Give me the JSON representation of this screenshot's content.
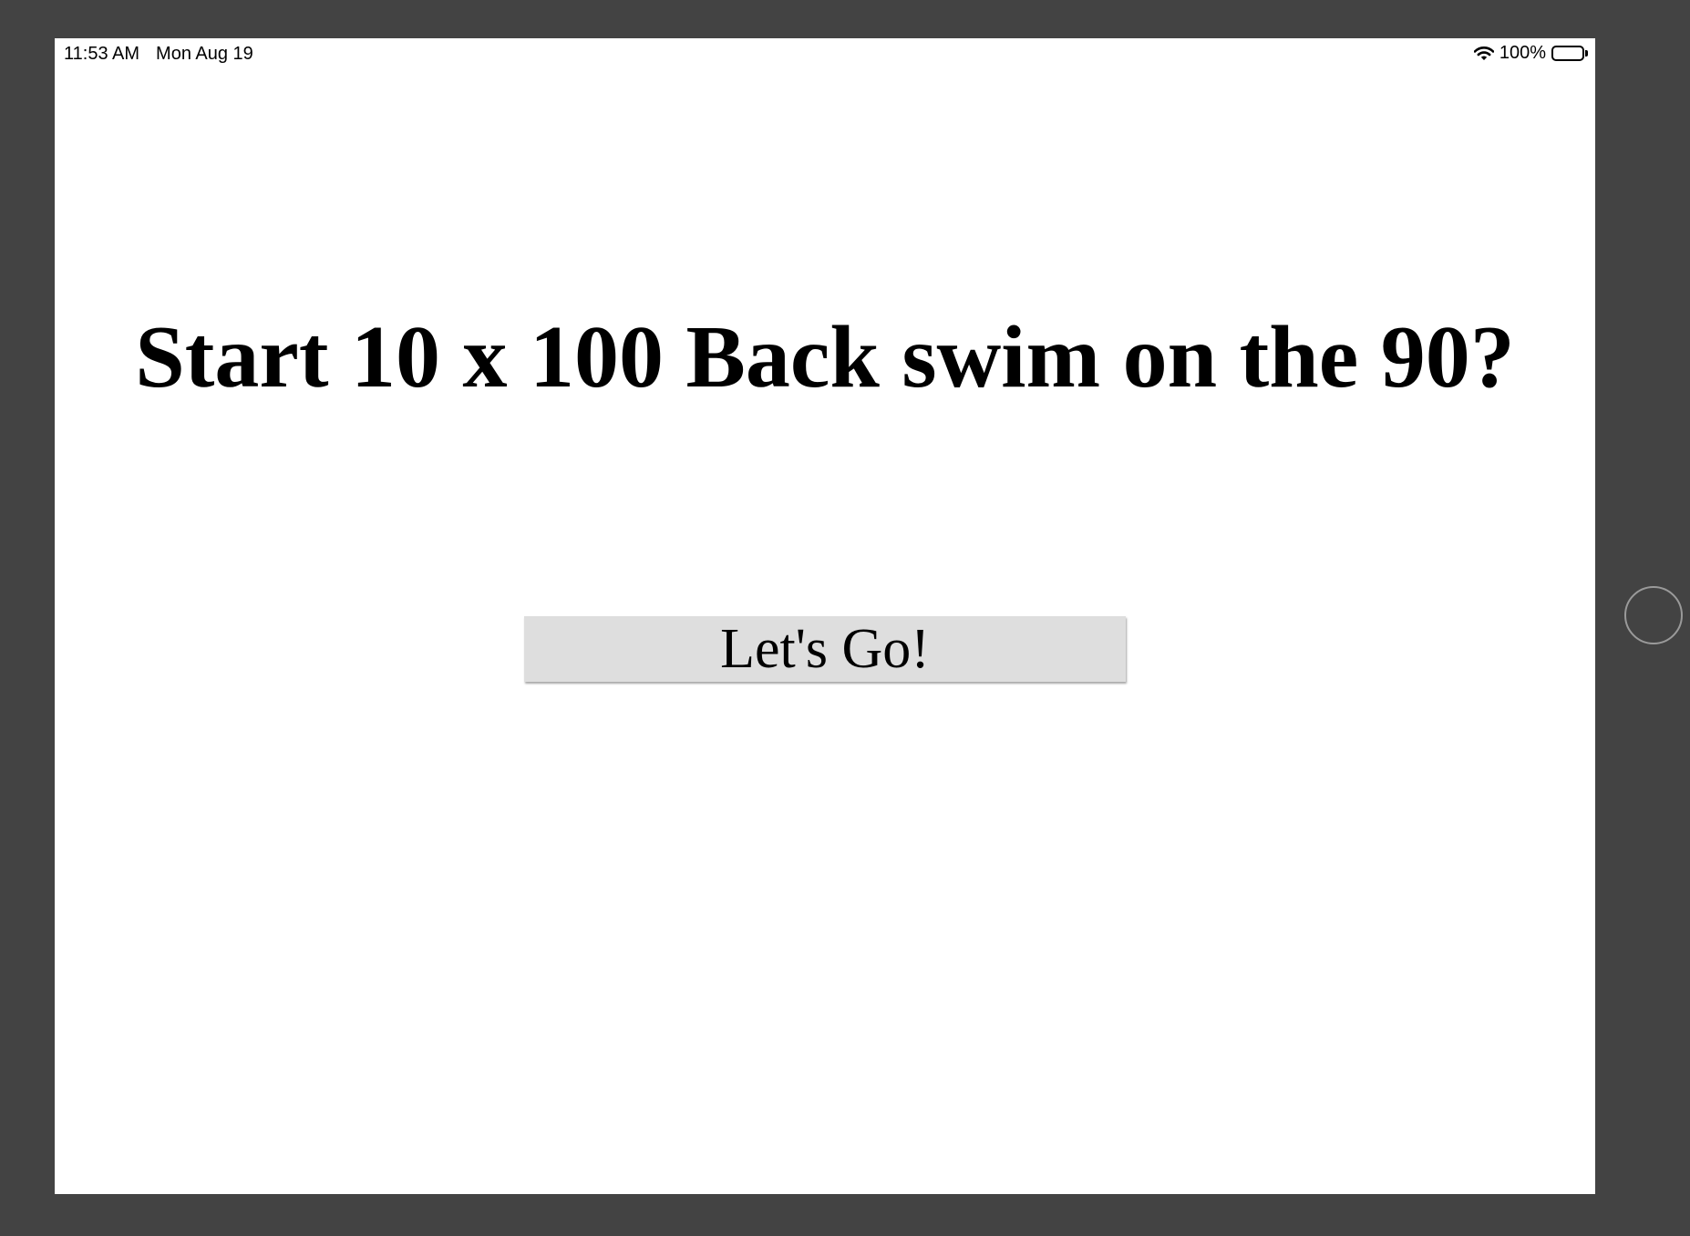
{
  "status_bar": {
    "time": "11:53 AM",
    "date": "Mon Aug 19",
    "battery_percent": "100%",
    "battery_level": 1.0,
    "icons": [
      "wifi-icon",
      "battery-icon"
    ]
  },
  "main": {
    "headline": "Start 10 x 100 Back swim on the 90?",
    "button_label": "Let's Go!"
  },
  "colors": {
    "bezel": "#434343",
    "screen": "#ffffff",
    "button": "#dedede",
    "text": "#000000"
  }
}
